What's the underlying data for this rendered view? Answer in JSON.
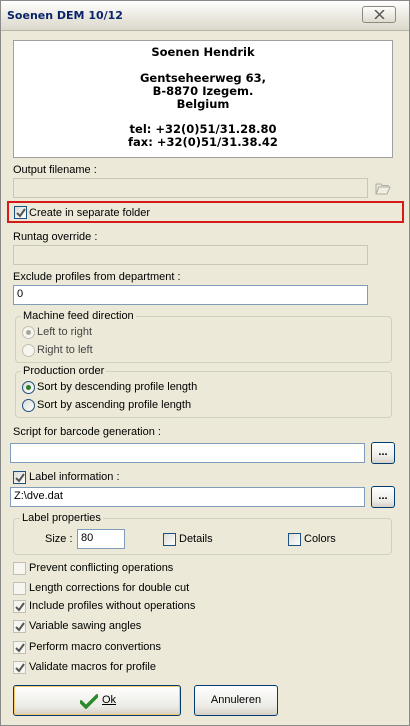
{
  "window": {
    "title": "Soenen DEM 10/12",
    "close_icon": "close-icon"
  },
  "address": {
    "name": "Soenen Hendrik",
    "street": "Gentseheerweg 63,",
    "city": "B-8870 Izegem.",
    "country": "Belgium",
    "tel": "tel: +32(0)51/31.28.80",
    "fax": "fax: +32(0)51/31.38.42"
  },
  "output_filename": {
    "label": "Output filename :",
    "value": ""
  },
  "create_separate_folder": {
    "label": "Create in separate folder",
    "checked": true
  },
  "runtag_override": {
    "label": "Runtag override :",
    "value": ""
  },
  "exclude_profiles": {
    "label": "Exclude profiles from department :",
    "value": "0"
  },
  "machine_feed": {
    "title": "Machine feed direction",
    "options": [
      "Left to right",
      "Right to left"
    ],
    "selected": "Left to right"
  },
  "production_order": {
    "title": "Production order",
    "options": [
      "Sort by descending profile length",
      "Sort by ascending profile length"
    ],
    "selected": "Sort by descending profile length"
  },
  "barcode_script": {
    "label": "Script for barcode generation :",
    "value": "",
    "browse_label": "..."
  },
  "label_information": {
    "label": "Label information :",
    "checked": true,
    "value": "Z:\\dve.dat",
    "browse_label": "..."
  },
  "label_properties": {
    "title": "Label properties",
    "size_label": "Size :",
    "size_value": "80",
    "details_label": "Details",
    "colors_label": "Colors"
  },
  "options": [
    {
      "label": "Prevent conflicting operations",
      "checked": false
    },
    {
      "label": "Length corrections for double cut",
      "checked": false
    },
    {
      "label": "Include profiles without operations",
      "checked": true
    },
    {
      "label": "Variable sawing angles",
      "checked": true
    },
    {
      "label": "Perform macro convertions",
      "checked": true
    },
    {
      "label": "Validate macros for profile",
      "checked": true
    }
  ],
  "buttons": {
    "ok": "Ok",
    "cancel": "Annuleren"
  },
  "colors": {
    "highlight": "#d51a1a",
    "check": "#2c7e2c"
  }
}
